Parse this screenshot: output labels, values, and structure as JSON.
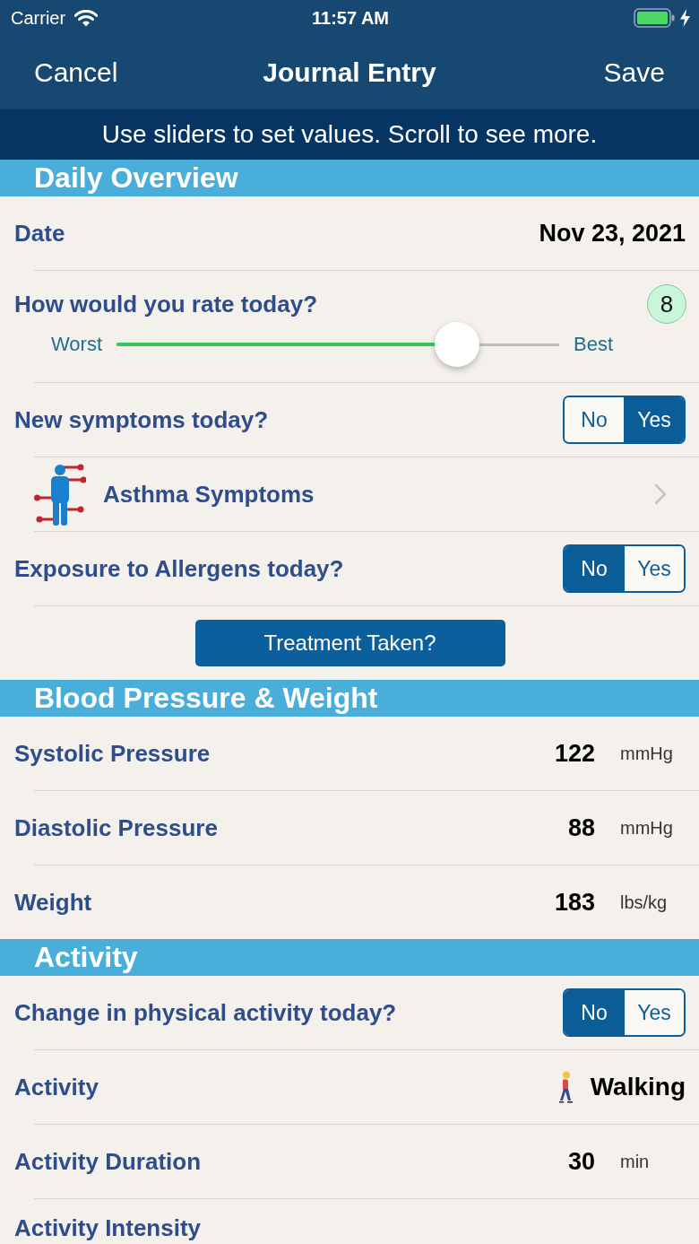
{
  "status_bar": {
    "carrier": "Carrier",
    "time": "11:57 AM"
  },
  "nav_bar": {
    "cancel": "Cancel",
    "title": "Journal Entry",
    "save": "Save"
  },
  "banner": "Use sliders to set values. Scroll to see more.",
  "sections": [
    {
      "title": "Daily Overview",
      "rows": [
        {
          "kind": "value",
          "label": "Date",
          "value": "Nov 23, 2021"
        },
        {
          "kind": "rating",
          "label": "How would you rate today?",
          "reading": "8",
          "min_label": "Worst",
          "max_label": "Best",
          "level": 0.77
        },
        {
          "kind": "toggle",
          "label": "New symptoms today?",
          "options": [
            {
              "label": "No",
              "selected": false
            },
            {
              "label": "Yes",
              "selected": true
            }
          ]
        },
        {
          "kind": "link",
          "label": "Asthma Symptoms"
        },
        {
          "kind": "toggle",
          "label": "Exposure to Allergens today?",
          "options": [
            {
              "label": "No",
              "selected": true
            },
            {
              "label": "Yes",
              "selected": false
            }
          ]
        },
        {
          "kind": "button",
          "label": "Treatment Taken?"
        }
      ]
    },
    {
      "title": "Blood Pressure & Weight",
      "rows": [
        {
          "kind": "measure",
          "label": "Systolic Pressure",
          "value": "122",
          "unit": "mmHg"
        },
        {
          "kind": "measure",
          "label": "Diastolic Pressure",
          "value": "88",
          "unit": "mmHg"
        },
        {
          "kind": "measure",
          "label": "Weight",
          "value": "183",
          "unit": "lbs/kg"
        }
      ]
    },
    {
      "title": "Activity",
      "rows": [
        {
          "kind": "toggle",
          "label": "Change in physical activity today?",
          "options": [
            {
              "label": "No",
              "selected": true
            },
            {
              "label": "Yes",
              "selected": false
            }
          ]
        },
        {
          "kind": "activity",
          "label": "Activity",
          "value": "Walking"
        },
        {
          "kind": "measure",
          "label": "Activity Duration",
          "value": "30",
          "unit": "min"
        },
        {
          "kind": "heading",
          "label": "Activity Intensity"
        }
      ]
    }
  ]
}
